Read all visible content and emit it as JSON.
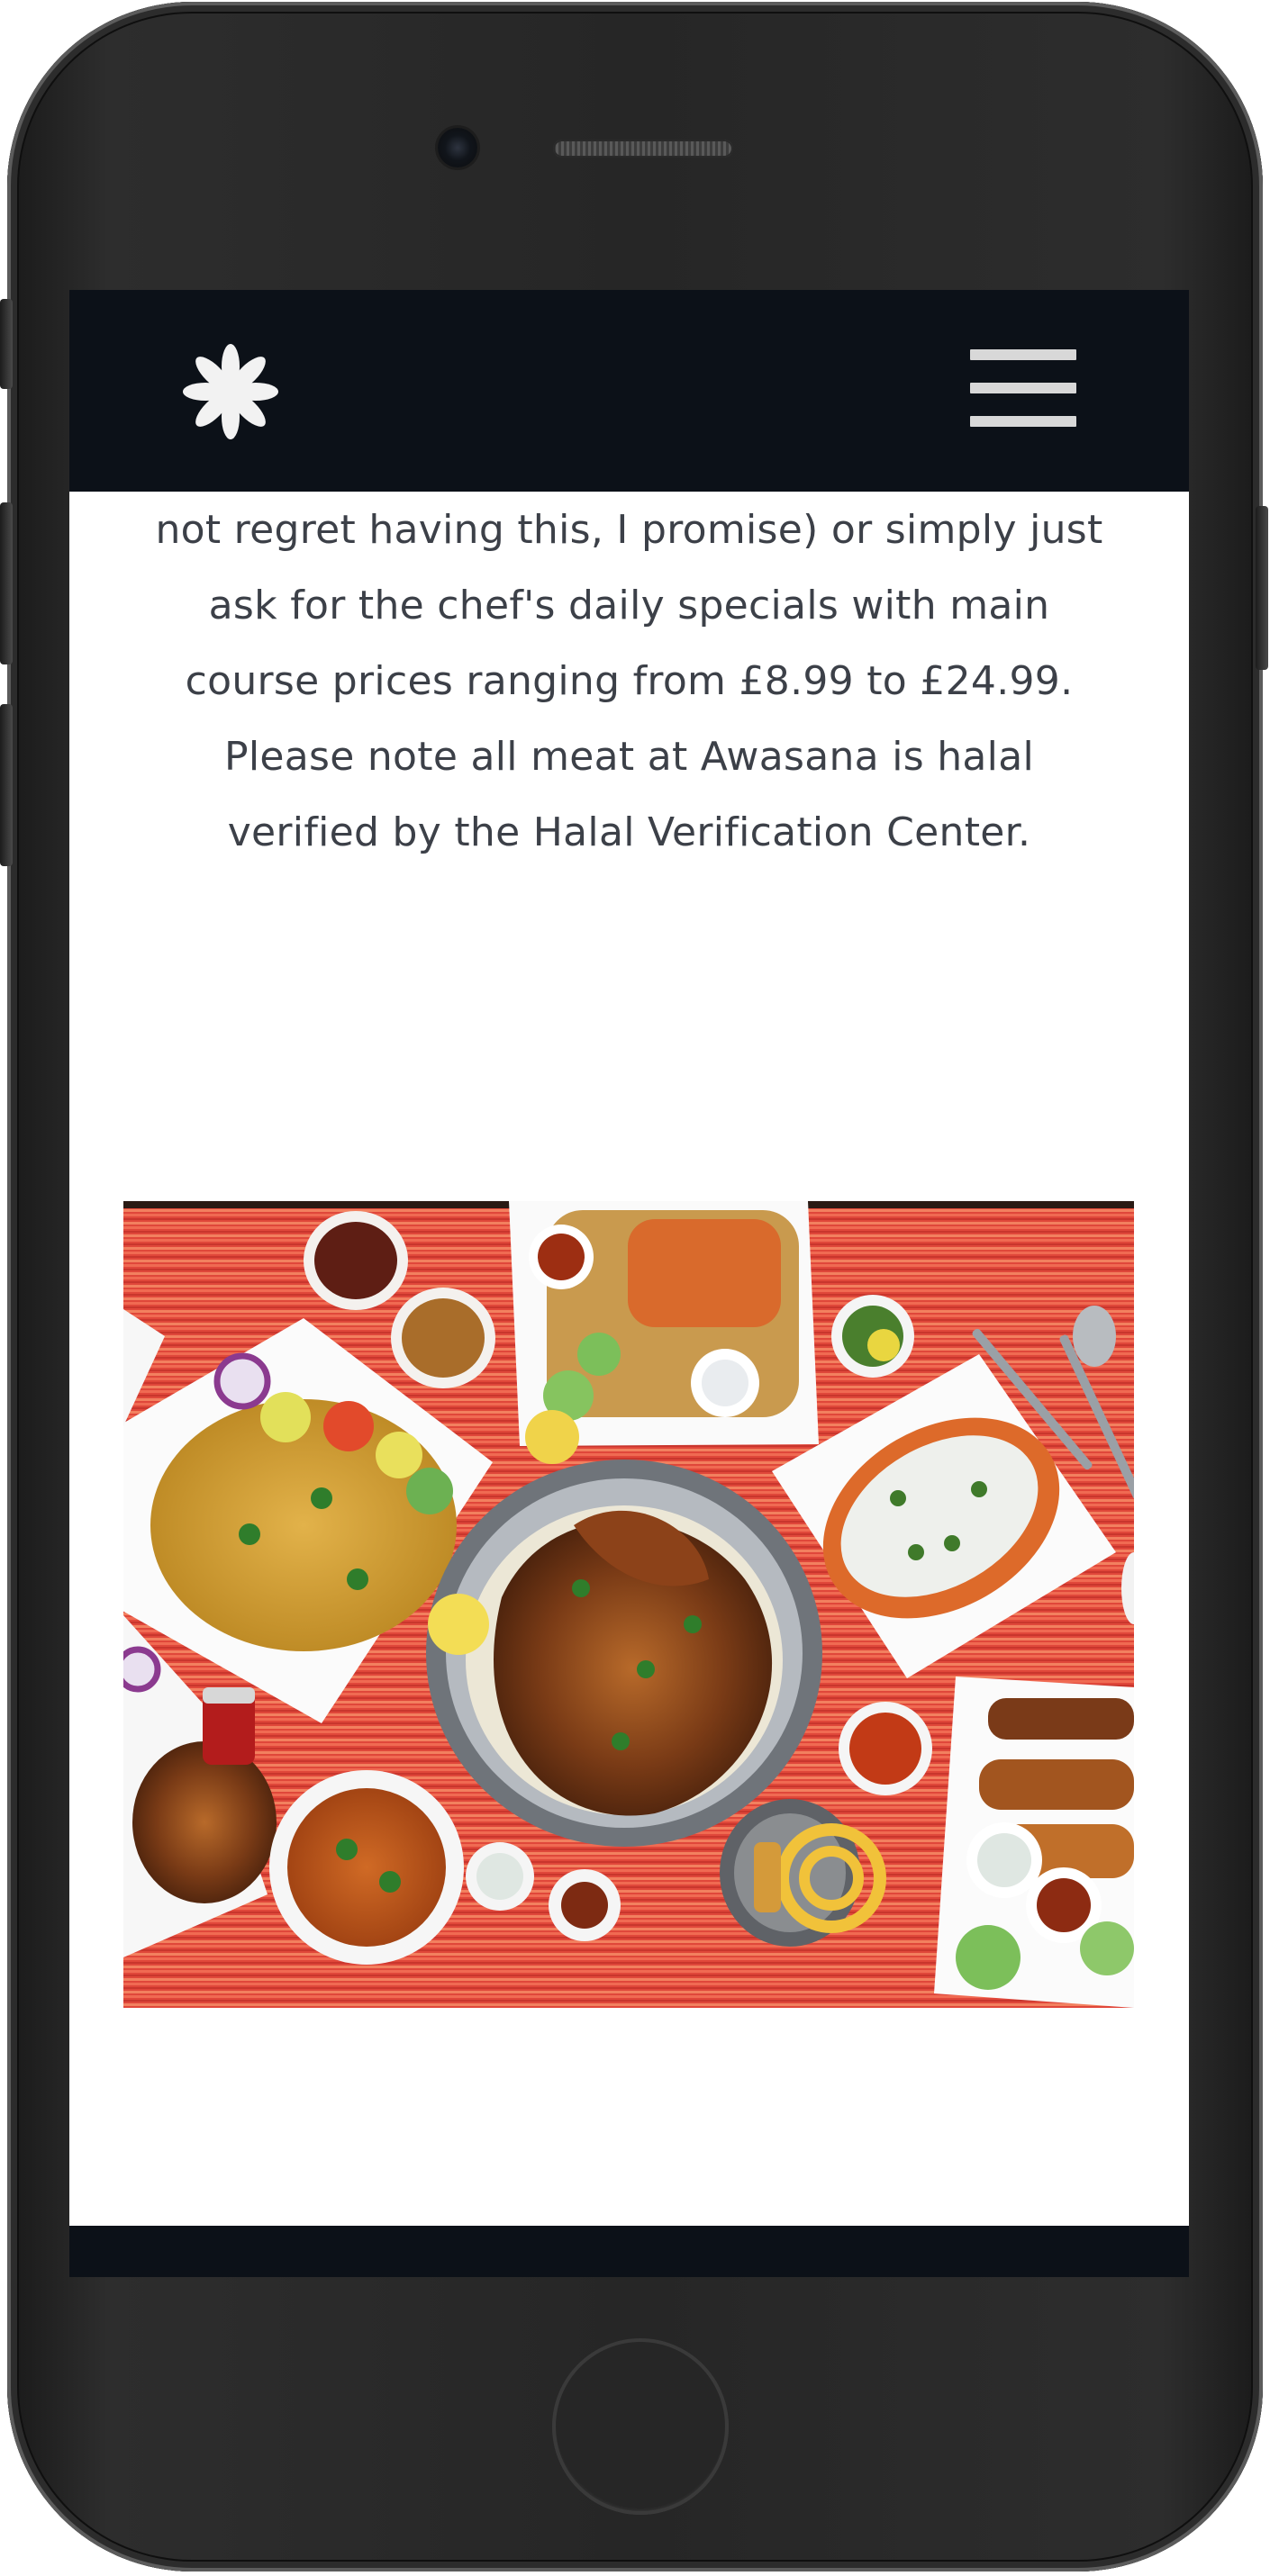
{
  "header": {
    "logo_icon": "asterisk-flower-icon",
    "menu_icon": "hamburger-menu-icon"
  },
  "content": {
    "paragraph_lines": [
      "not regret having this, I promise) or simply just",
      "ask for the chef's daily specials with main",
      "course prices ranging from £8.99 to £24.99.",
      "Please note all meat at Awasana is halal",
      "verified by the Halal Verification Center."
    ]
  },
  "image": {
    "subject": "food-spread-photo"
  },
  "colors": {
    "navbar": "#0c1118",
    "text": "#3c4048",
    "tablecloth": "#e0473a"
  }
}
